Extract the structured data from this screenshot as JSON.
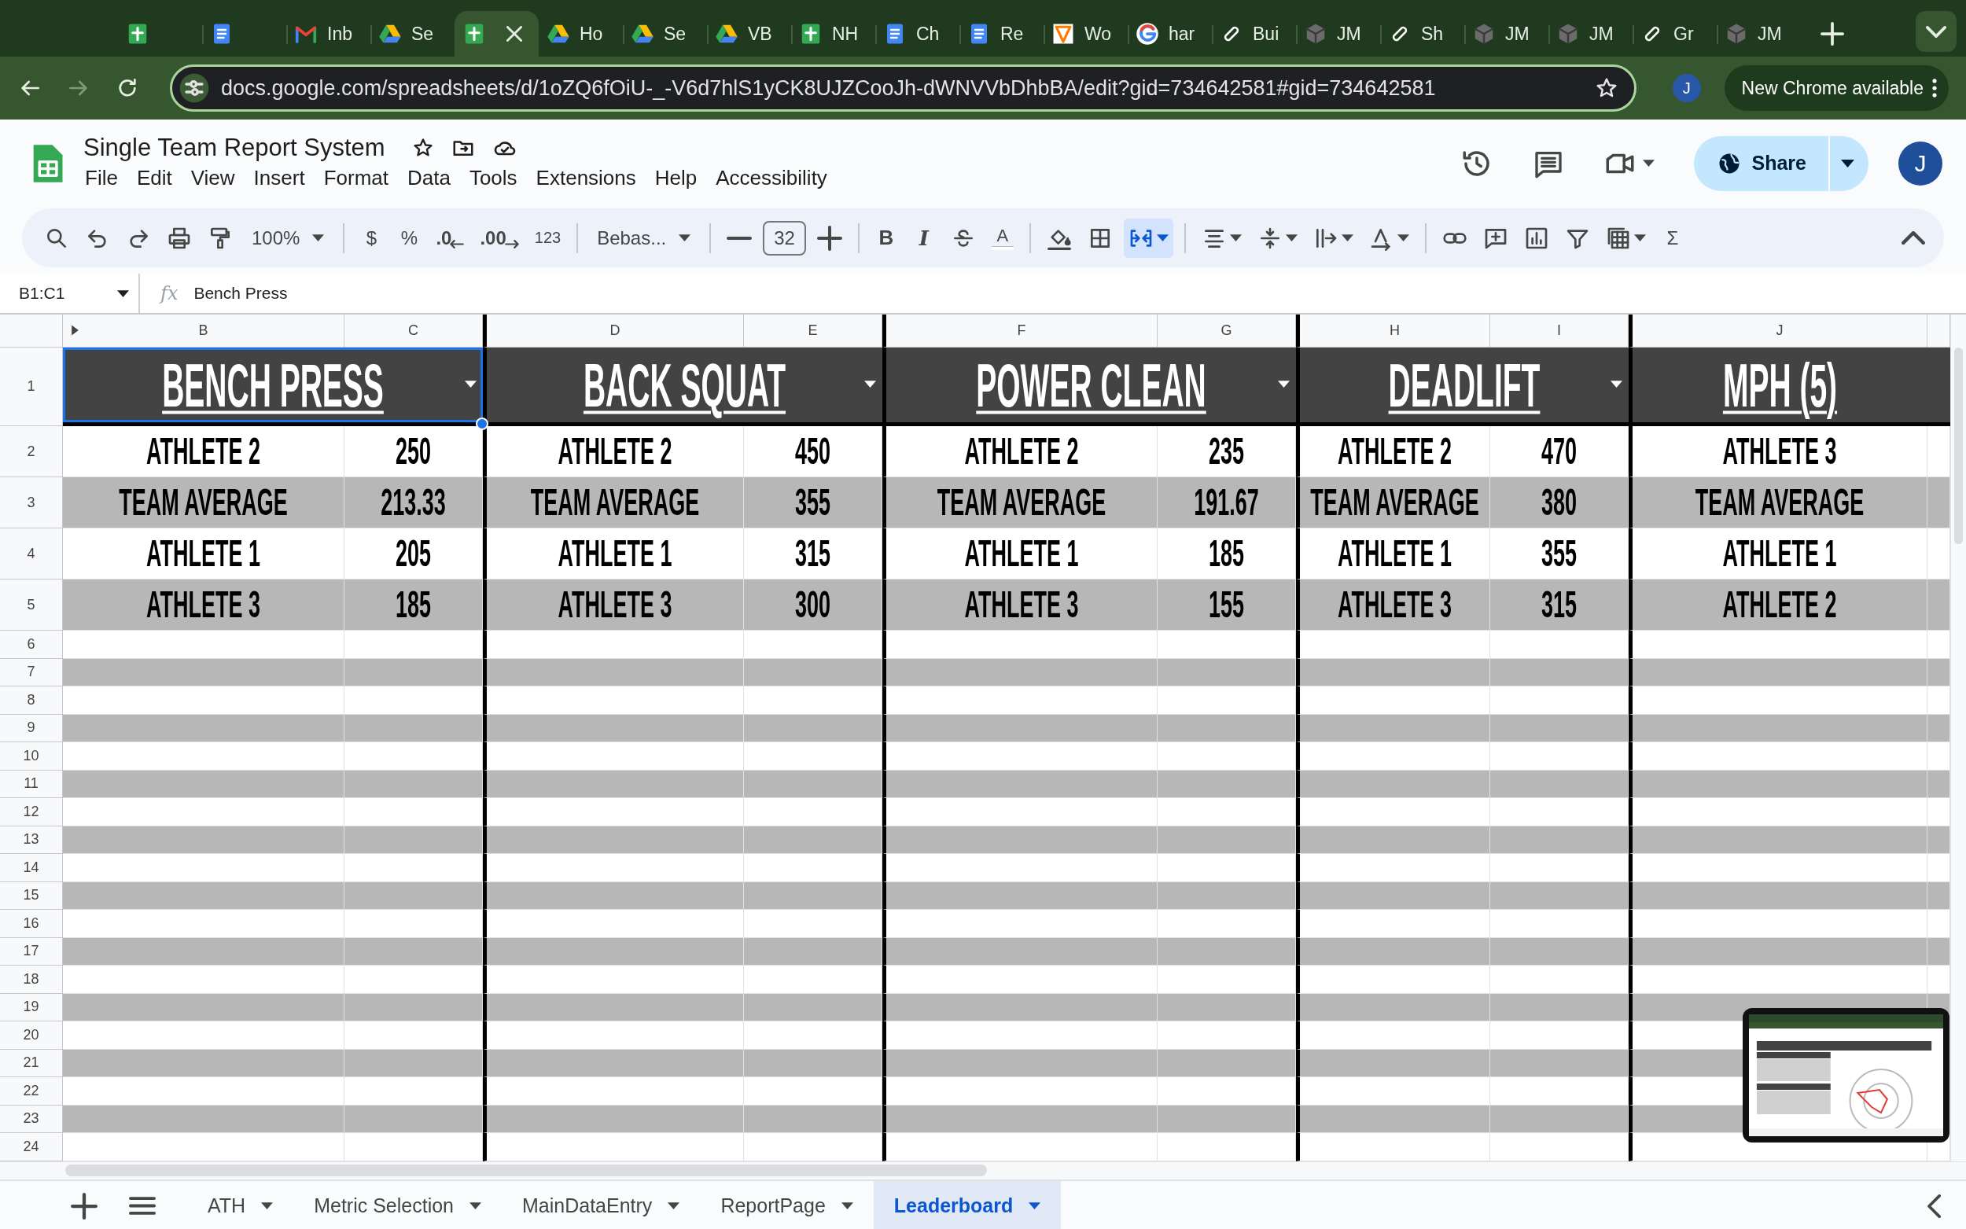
{
  "browser": {
    "tabs": [
      {
        "kind": "sheets",
        "selected": false
      },
      {
        "kind": "docs",
        "selected": false
      },
      {
        "kind": "mail",
        "label": "Inb",
        "selected": false
      },
      {
        "kind": "drive",
        "label": "Se",
        "selected": false
      },
      {
        "kind": "sheets",
        "selected": true
      },
      {
        "kind": "drive",
        "label": "Ho",
        "selected": false
      },
      {
        "kind": "drive",
        "label": "Se",
        "selected": false
      },
      {
        "kind": "drive",
        "label": "VB",
        "selected": false
      },
      {
        "kind": "sheets",
        "label": "NH",
        "selected": false
      },
      {
        "kind": "docs",
        "label": "Ch",
        "selected": false
      },
      {
        "kind": "docs",
        "label": "Re",
        "selected": false
      },
      {
        "kind": "shield",
        "label": "Wo",
        "selected": false
      },
      {
        "kind": "ring",
        "label": "har",
        "selected": false
      },
      {
        "kind": "swirl",
        "label": "Bui",
        "selected": false
      },
      {
        "kind": "cube",
        "label": "JM",
        "selected": false
      },
      {
        "kind": "swirl",
        "label": "Sh",
        "selected": false
      },
      {
        "kind": "cube",
        "label": "JM",
        "selected": false
      },
      {
        "kind": "cube",
        "label": "JM",
        "selected": false
      },
      {
        "kind": "swirl",
        "label": "Gr",
        "selected": false
      },
      {
        "kind": "cube",
        "label": "JM",
        "selected": false
      }
    ],
    "url": "docs.google.com/spreadsheets/d/1oZQ6fOiU-_-V6d7hlS1yCK8UJZCooJh-dWNVVbDhbBA/edit?gid=734642581#gid=734642581",
    "profile": "J",
    "update": "New Chrome available"
  },
  "doc": {
    "title": "Single Team Report System",
    "menus": [
      "File",
      "Edit",
      "View",
      "Insert",
      "Format",
      "Data",
      "Tools",
      "Extensions",
      "Help",
      "Accessibility"
    ],
    "share": "Share",
    "avatar": "J"
  },
  "toolbar": [
    [
      {
        "kind": "search",
        "active": false
      },
      {
        "kind": "undo",
        "active": false
      },
      {
        "kind": "redo",
        "active": false
      },
      {
        "kind": "print",
        "active": false
      },
      {
        "kind": "paint",
        "active": false
      },
      {
        "kind": "select",
        "text": "100%",
        "active": false
      }
    ],
    [
      {
        "kind": "text",
        "text": "$",
        "active": false
      },
      {
        "kind": "text",
        "text": "%",
        "active": false
      },
      {
        "kind": "decimal-less",
        "text": ".0",
        "active": false
      },
      {
        "kind": "decimal-more",
        "text": ".00",
        "active": false
      },
      {
        "kind": "small",
        "text": "123",
        "active": false
      }
    ],
    [
      {
        "kind": "select",
        "text": "Bebas...",
        "active": false
      }
    ],
    [
      {
        "kind": "minus",
        "active": false
      },
      {
        "kind": "field",
        "text": "32",
        "active": false
      },
      {
        "kind": "plus",
        "active": false
      }
    ],
    [
      {
        "kind": "bold",
        "text": "B",
        "active": false
      },
      {
        "kind": "italic",
        "text": "I",
        "active": false
      },
      {
        "kind": "strike",
        "active": false
      },
      {
        "kind": "color",
        "text": "A",
        "active": false
      }
    ],
    [
      {
        "kind": "fill",
        "active": false
      },
      {
        "kind": "borders",
        "active": false
      },
      {
        "kind": "merge",
        "menu": true,
        "active": true
      }
    ],
    [
      {
        "kind": "align",
        "menu": true,
        "active": false
      },
      {
        "kind": "valign",
        "menu": true,
        "active": false
      },
      {
        "kind": "wrap",
        "menu": true,
        "active": false
      },
      {
        "kind": "rotate",
        "menu": true,
        "active": false
      }
    ],
    [
      {
        "kind": "link",
        "active": false
      },
      {
        "kind": "comment",
        "active": false
      },
      {
        "kind": "chart",
        "active": false
      },
      {
        "kind": "filter",
        "active": false
      },
      {
        "kind": "table",
        "menu": true,
        "active": false
      },
      {
        "kind": "text",
        "text": "Σ",
        "active": false
      }
    ]
  ],
  "formula_bar": {
    "name_box": "B1:C1",
    "fx": "fx",
    "formula": "Bench Press"
  },
  "sheet": {
    "columns": [
      "B",
      "C",
      "D",
      "E",
      "F",
      "G",
      "H",
      "I",
      "J"
    ],
    "row_numbers": [
      "1",
      "2",
      "3",
      "4",
      "5",
      "6",
      "7",
      "8",
      "9",
      "10",
      "11",
      "12",
      "13",
      "14",
      "15",
      "16",
      "17",
      "18",
      "19",
      "20",
      "21",
      "22",
      "23",
      "24"
    ],
    "groups": [
      {
        "title": "BENCH PRESS",
        "dropdown": true,
        "selected": true,
        "rows": [
          {
            "name": "ATHLETE 2",
            "value": "250"
          },
          {
            "name": "TEAM AVERAGE",
            "value": "213.33"
          },
          {
            "name": "ATHLETE 1",
            "value": "205"
          },
          {
            "name": "ATHLETE 3",
            "value": "185"
          }
        ]
      },
      {
        "title": "BACK SQUAT",
        "dropdown": true,
        "selected": false,
        "rows": [
          {
            "name": "ATHLETE 2",
            "value": "450"
          },
          {
            "name": "TEAM AVERAGE",
            "value": "355"
          },
          {
            "name": "ATHLETE 1",
            "value": "315"
          },
          {
            "name": "ATHLETE 3",
            "value": "300"
          }
        ]
      },
      {
        "title": "POWER CLEAN",
        "dropdown": true,
        "selected": false,
        "rows": [
          {
            "name": "ATHLETE 2",
            "value": "235"
          },
          {
            "name": "TEAM AVERAGE",
            "value": "191.67"
          },
          {
            "name": "ATHLETE 1",
            "value": "185"
          },
          {
            "name": "ATHLETE 3",
            "value": "155"
          }
        ]
      },
      {
        "title": "DEADLIFT",
        "dropdown": true,
        "selected": false,
        "rows": [
          {
            "name": "ATHLETE 2",
            "value": "470"
          },
          {
            "name": "TEAM AVERAGE",
            "value": "380"
          },
          {
            "name": "ATHLETE 1",
            "value": "355"
          },
          {
            "name": "ATHLETE 3",
            "value": "315"
          }
        ]
      },
      {
        "title": "MPH (5)",
        "dropdown": false,
        "selected": false,
        "rows": [
          {
            "name": "ATHLETE 3"
          },
          {
            "name": "TEAM AVERAGE"
          },
          {
            "name": "ATHLETE 1"
          },
          {
            "name": "ATHLETE 2"
          }
        ]
      }
    ],
    "overlay": {
      "kind": "picture"
    }
  },
  "sheet_tabs": [
    {
      "label": "ATH",
      "selected": false
    },
    {
      "label": "Metric Selection",
      "selected": false
    },
    {
      "label": "MainDataEntry",
      "selected": false
    },
    {
      "label": "ReportPage",
      "selected": false
    },
    {
      "label": "Leaderboard",
      "selected": true
    }
  ]
}
